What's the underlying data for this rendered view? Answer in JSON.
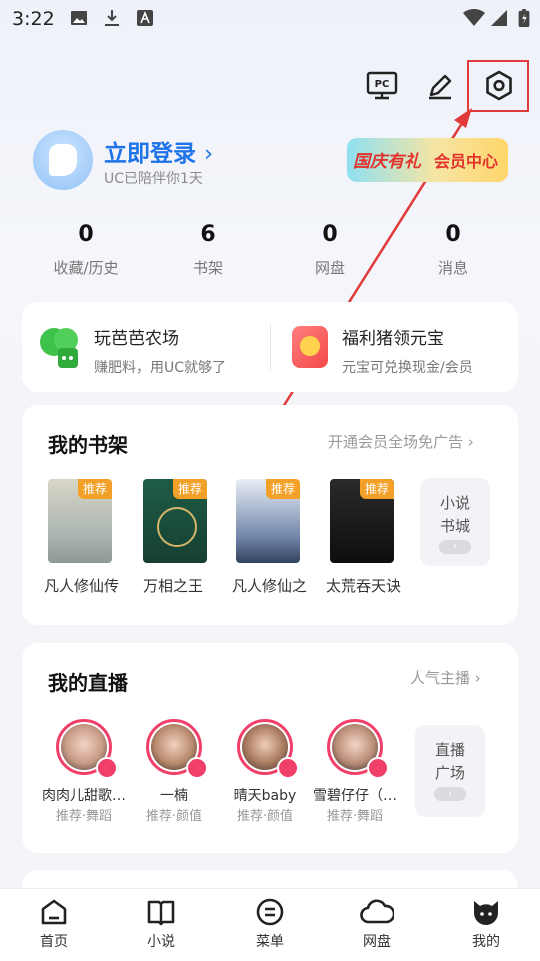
{
  "status_bar": {
    "time": "3:22"
  },
  "profile": {
    "login_label": "立即登录",
    "subtitle": "UC已陪伴你1天",
    "vip_left": "国庆有礼",
    "vip_right": "会员中心"
  },
  "stats": [
    {
      "value": "0",
      "label": "收藏/历史"
    },
    {
      "value": "6",
      "label": "书架"
    },
    {
      "value": "0",
      "label": "网盘"
    },
    {
      "value": "0",
      "label": "消息"
    }
  ],
  "promo": [
    {
      "title": "玩芭芭农场",
      "subtitle": "赚肥料，用UC就够了"
    },
    {
      "title": "福利猪领元宝",
      "subtitle": "元宝可兑换现金/会员"
    }
  ],
  "bookshelf": {
    "title": "我的书架",
    "link": "开通会员全场免广告",
    "tag": "推荐",
    "books": [
      {
        "name": "凡人修仙传"
      },
      {
        "name": "万相之王"
      },
      {
        "name": "凡人修仙之"
      },
      {
        "name": "太荒吞天诀"
      }
    ],
    "more_line1": "小说",
    "more_line2": "书城"
  },
  "live": {
    "title": "我的直播",
    "link": "人气主播",
    "hosts": [
      {
        "name": "肉肉儿甜歌…",
        "sub": "推荐·舞蹈"
      },
      {
        "name": "一楠",
        "sub": "推荐·颜值"
      },
      {
        "name": "晴天baby",
        "sub": "推荐·颜值"
      },
      {
        "name": "雪碧仔仔（…",
        "sub": "推荐·舞蹈"
      }
    ],
    "more_line1": "直播",
    "more_line2": "广场"
  },
  "tabs": [
    {
      "label": "首页",
      "icon": "home-icon"
    },
    {
      "label": "小说",
      "icon": "book-icon"
    },
    {
      "label": "菜单",
      "icon": "menu-icon"
    },
    {
      "label": "网盘",
      "icon": "cloud-icon"
    },
    {
      "label": "我的",
      "icon": "profile-icon"
    }
  ],
  "colors": {
    "accent": "#1e73e8",
    "highlight_box": "#e03a3a",
    "live_ring": "#f0406a",
    "tag": "#f2a028"
  }
}
